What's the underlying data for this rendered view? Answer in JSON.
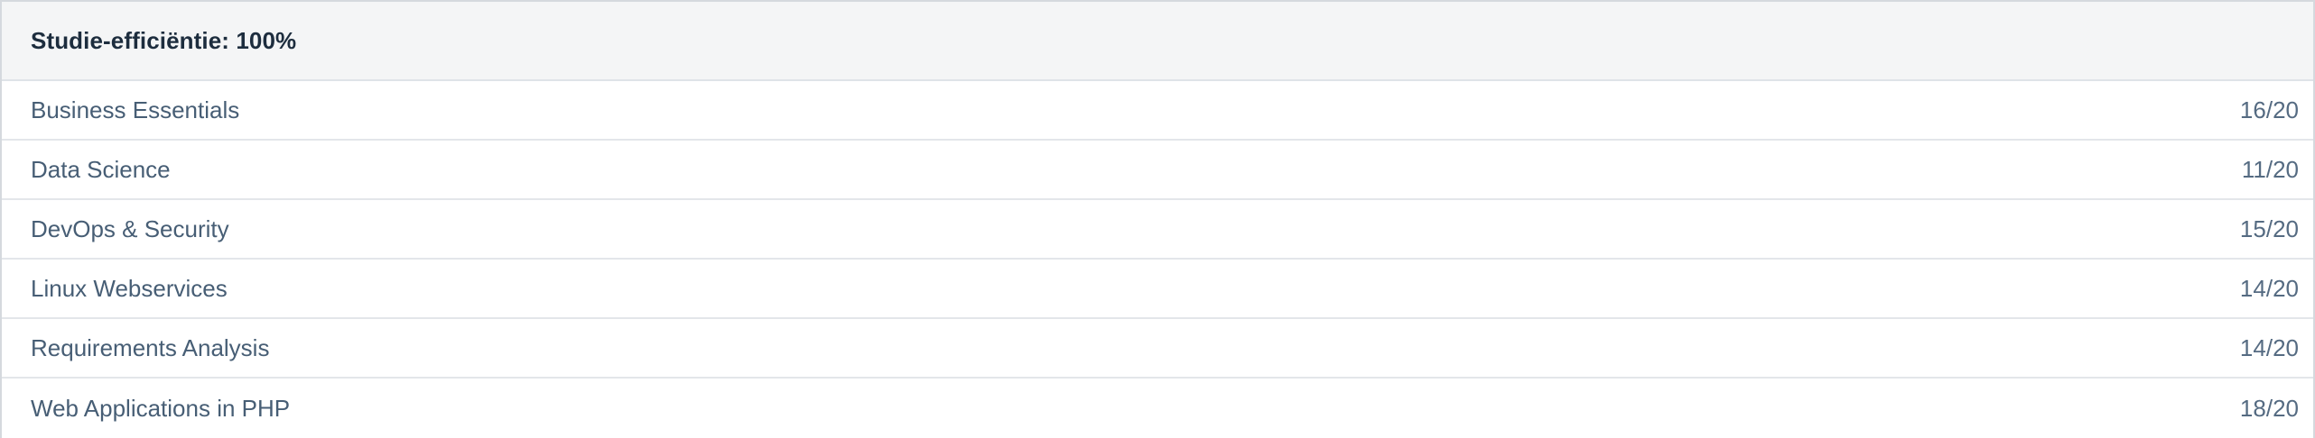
{
  "header": {
    "title": "Studie-efficiëntie: 100%"
  },
  "courses": [
    {
      "name": "Business Essentials",
      "score": "16/20"
    },
    {
      "name": "Data Science",
      "score": "11/20"
    },
    {
      "name": "DevOps & Security",
      "score": "15/20"
    },
    {
      "name": "Linux Webservices",
      "score": "14/20"
    },
    {
      "name": "Requirements Analysis",
      "score": "14/20"
    },
    {
      "name": "Web Applications in PHP",
      "score": "18/20"
    }
  ],
  "colors": {
    "header_bg": "#f4f5f6",
    "title_text": "#1d2d3e",
    "row_text": "#475e75",
    "divider": "#e3e6ea"
  }
}
